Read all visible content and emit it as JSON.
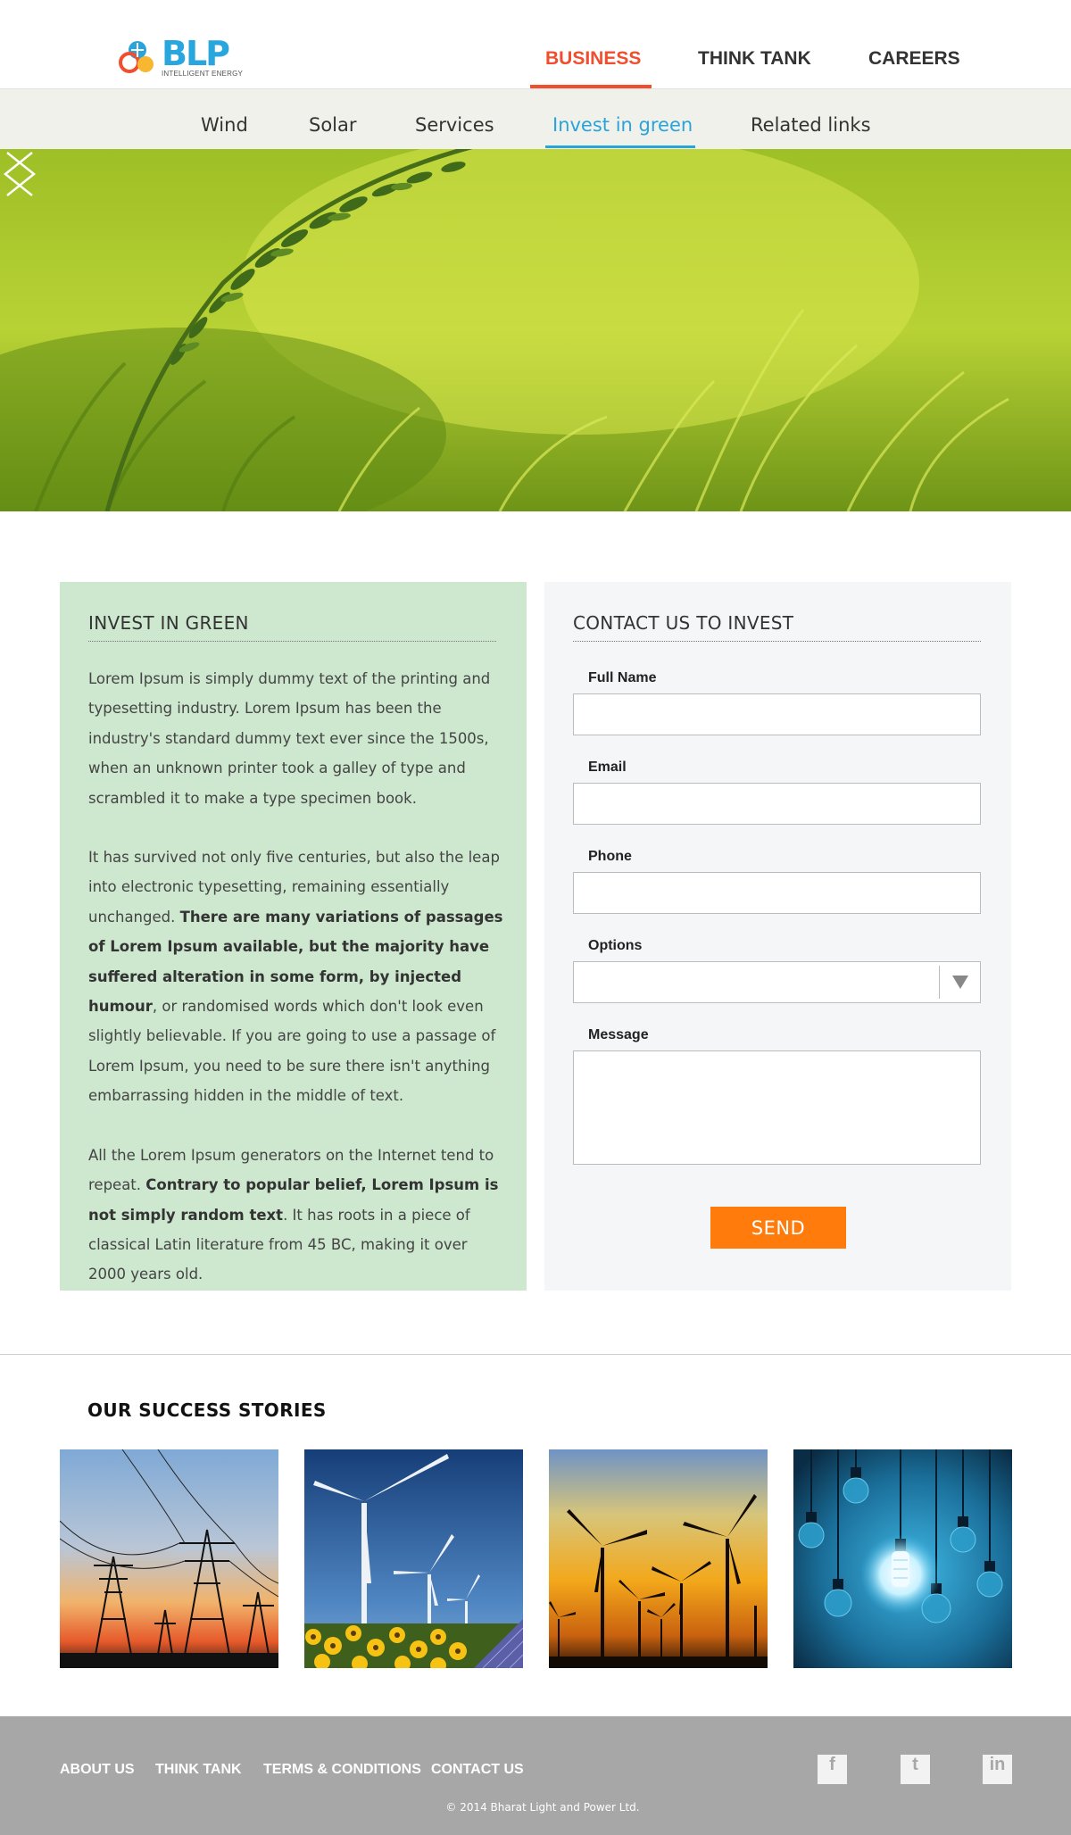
{
  "brand": {
    "name": "BLP",
    "tagline": "INTELLIGENT ENERGY",
    "colors": {
      "accent_red": "#f04e2e",
      "accent_blue": "#29a3d9",
      "send_orange": "#ff7b0c",
      "invest_green_bg": "#cde8cf"
    }
  },
  "main_nav": {
    "items": [
      {
        "label": "BUSINESS",
        "active": true
      },
      {
        "label": "THINK TANK",
        "active": false
      },
      {
        "label": "CAREERS",
        "active": false
      }
    ]
  },
  "sub_nav": {
    "items": [
      {
        "label": "Wind",
        "active": false
      },
      {
        "label": "Solar",
        "active": false
      },
      {
        "label": "Services",
        "active": false
      },
      {
        "label": "Invest in green",
        "active": true
      },
      {
        "label": "Related links",
        "active": false
      }
    ]
  },
  "hero": {
    "prev_icon": "chevron-left-icon",
    "next_icon": "chevron-right-icon"
  },
  "invest": {
    "title": "INVEST IN GREEN",
    "p1": "Lorem Ipsum is simply dummy text of the printing and typesetting industry. Lorem Ipsum has been the industry's standard dummy text ever since the 1500s, when an unknown printer took a galley of type and scrambled it to make a type specimen book.",
    "p2_start": "It has survived not only five centuries, but also the leap into electronic typesetting, remaining essentially unchanged.",
    "p2_bold": "There are many variations of passages of Lorem Ipsum available, but the majority have suffered alteration in some form, by injected humour",
    "p2_end": ", or randomised words which don't look even slightly believable. If you are going to use a passage of Lorem Ipsum, you need to be sure there isn't anything embarrassing hidden in the middle of text.",
    "p3_start": "All the Lorem Ipsum generators on the Internet tend to repeat.",
    "p3_bold": "Contrary to popular belief, Lorem Ipsum is not simply random text",
    "p3_end": ". It has roots in a piece of classical Latin literature from 45 BC, making it over 2000 years old."
  },
  "contact": {
    "title": "CONTACT US TO INVEST",
    "fields": {
      "full_name": {
        "label": "Full Name",
        "value": ""
      },
      "email": {
        "label": "Email",
        "value": ""
      },
      "phone": {
        "label": "Phone",
        "value": ""
      },
      "options": {
        "label": "Options",
        "value": ""
      },
      "message": {
        "label": "Message",
        "value": ""
      }
    },
    "send_label": "SEND"
  },
  "stories": {
    "title": "OUR SUCCESS STORIES",
    "items": [
      {
        "subject": "power-lines-sunset"
      },
      {
        "subject": "wind-turbines-sunflowers"
      },
      {
        "subject": "wind-farm-silhouette"
      },
      {
        "subject": "hanging-light-bulbs"
      }
    ]
  },
  "footer": {
    "links": [
      "ABOUT US",
      "THINK TANK",
      "TERMS & CONDITIONS",
      "CONTACT US"
    ],
    "social": [
      {
        "icon": "facebook-icon",
        "glyph": "f"
      },
      {
        "icon": "twitter-icon",
        "glyph": "t"
      },
      {
        "icon": "linkedin-icon",
        "glyph": "in"
      }
    ],
    "copyright": "© 2014 Bharat Light and Power Ltd."
  }
}
